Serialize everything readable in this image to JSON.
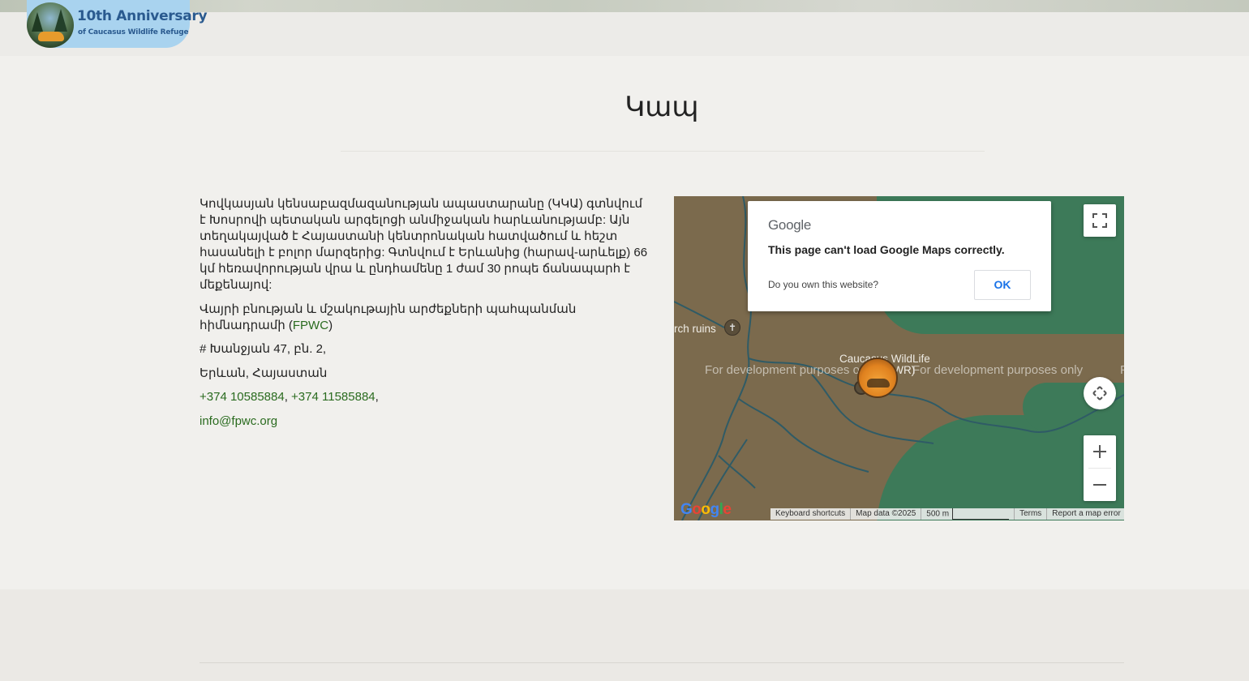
{
  "header": {
    "logo_line1": "10th Anniversary",
    "logo_line2": "of Caucasus Wildlife Refuge",
    "logo_icon": "tiger-mountain-emblem-icon"
  },
  "page": {
    "title": "Կապ"
  },
  "contact": {
    "description": "Կովկասյան կենսաբազմազանության ապաստարանը (ԿԿԱ) գտնվում է  Խոսրովի պետական արգելոցի անմիջական հարևանությամբ: Այն տեղակայված է Հայաստանի կենտրոնական հատվածում և հեշտ հասանելի է բոլոր մարզերից: Գտնվում է Երևանից (հարավ-արևելք) 66 կմ հեռավորության վրա և ընդհամենը 1 ժամ 30 րոպե ճանապարհ է մեքենայով:",
    "org_prefix": "Վայրի բնության և մշակութային արժեքների պահպանման հիմնադրամի (",
    "org_link": "FPWC",
    "org_suffix": ")",
    "address_line1": "# Խանջյան 47, բն. 2,",
    "address_line2": "Երևան, Հայաստան",
    "phone1": "+374 10585884",
    "phone_sep": ", ",
    "phone2": "+374 11585884",
    "phone_trail": ",",
    "email": "info@fpwc.org"
  },
  "map": {
    "dialog_logo": "Google",
    "dialog_message": "This page can't load Google Maps correctly.",
    "dialog_question": "Do you own this website?",
    "dialog_ok": "OK",
    "watermark1": "For development purposes only",
    "watermark2": "For development purposes only",
    "watermark3": "F",
    "poi_church": "rch ruins",
    "poi_refuge_line1": "Caucasus WildLife",
    "poi_refuge_line2": "(CWR)",
    "footer_shortcuts": "Keyboard shortcuts",
    "footer_data": "Map data ©2025",
    "footer_scale": "500 m",
    "footer_terms": "Terms",
    "footer_report": "Report a map error",
    "google_logo": "Google",
    "colors": {
      "land": "#7b6a4d",
      "forest": "#3d7a59",
      "roads": "#2f5b66"
    }
  }
}
